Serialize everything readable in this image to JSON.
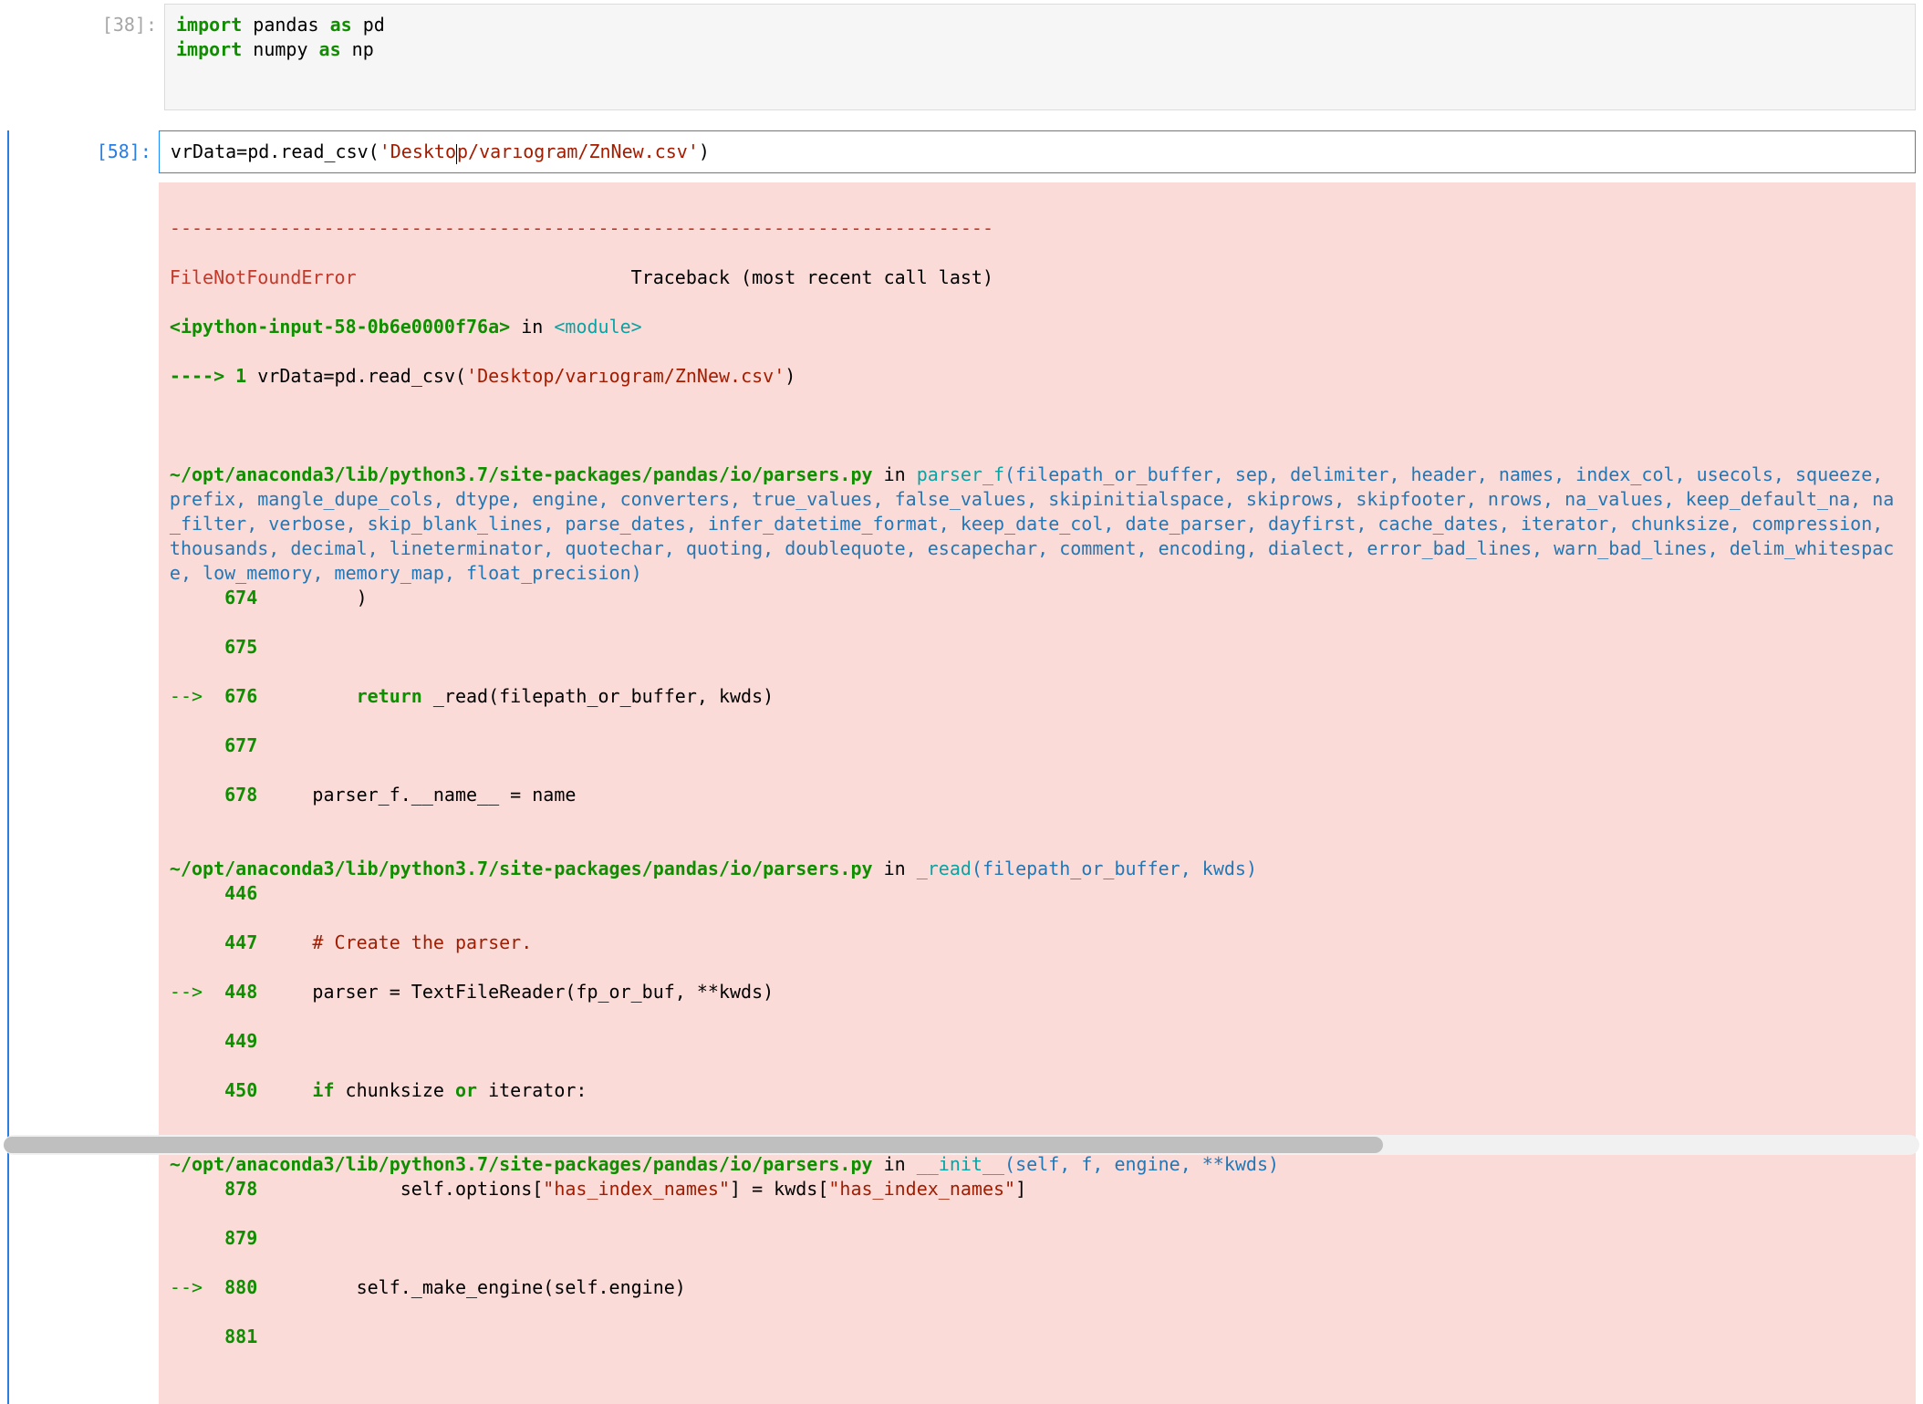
{
  "cell1": {
    "prompt": "[38]:",
    "line1_kw": "import",
    "line1_mid": " pandas ",
    "line1_as": "as",
    "line1_end": " pd",
    "line2_kw": "import",
    "line2_mid": " numpy ",
    "line2_as": "as",
    "line2_end": " np"
  },
  "cell2": {
    "prompt": "[58]:",
    "code_pre": "vrData=pd.read_csv(",
    "code_str_q1": "'",
    "code_str_a": "Deskto",
    "code_str_b": "p/varıogram/ZnNew.csv",
    "code_str_q2": "'",
    "code_post": ")"
  },
  "tb": {
    "dashes": "---------------------------------------------------------------------------",
    "err_name": "FileNotFoundError",
    "err_spacer": "                         ",
    "err_tail": "Traceback (most recent call last)",
    "ipy_in": "<ipython-input-58-0b6e0000f76a>",
    "in_word": " in ",
    "module": "<module>",
    "arrow_long": "----> ",
    "one": "1",
    "line1a": " vrData",
    "line1eq": "=",
    "line1b": "pd",
    "line1dot1": ".",
    "line1c": "read_csv",
    "line1paren": "(",
    "line1str": "'Desktop/varıogram/ZnNew.csv'",
    "line1close": ")",
    "loc1_path": "~/opt/anaconda3/lib/python3.7/site-packages/pandas/io/parsers.py",
    "loc1_fn": "parser_f",
    "loc1_args": "(filepath_or_buffer, sep, delimiter, header, names, index_col, usecols, squeeze, prefix, mangle_dupe_cols, dtype, engine, converters, true_values, false_values, skipinitialspace, skiprows, skipfooter, nrows, na_values, keep_default_na, na_filter, verbose, skip_blank_lines, parse_dates, infer_datetime_format, keep_date_col, date_parser, dayfirst, cache_dates, iterator, chunksize, compression, thousands, decimal, lineterminator, quotechar, quoting, doublequote, escapechar, comment, encoding, dialect, error_bad_lines, warn_bad_lines, delim_whitespace, low_memory, memory_map, float_precision)",
    "l674_no": "674",
    "l674_body": "        )",
    "l675_no": "675",
    "l675_body": "",
    "l676_arrow": "--> ",
    "l676_no": "676",
    "l676_return": "        return",
    "l676_body": " _read(filepath_or_buffer, kwds)",
    "l677_no": "677",
    "l677_body": "",
    "l678_no": "678",
    "l678_body": "    parser_f.__name__ = name",
    "loc2_path": "~/opt/anaconda3/lib/python3.7/site-packages/pandas/io/parsers.py",
    "loc2_fn": "_read",
    "loc2_args": "(filepath_or_buffer, kwds)",
    "l446_no": "446",
    "l446_body": "",
    "l447_no": "447",
    "l447_comment": "    # Create the parser.",
    "l448_arrow": "--> ",
    "l448_no": "448",
    "l448_body": "    parser = TextFileReader(fp_or_buf, **kwds)",
    "l449_no": "449",
    "l449_body": "",
    "l450_no": "450",
    "l450_if": "    if",
    "l450_body": " chunksize ",
    "l450_or": "or",
    "l450_body2": " iterator:",
    "loc3_path": "~/opt/anaconda3/lib/python3.7/site-packages/pandas/io/parsers.py",
    "loc3_fn": "__init__",
    "loc3_args": "(self, f, engine, **kwds)",
    "l878_no": "878",
    "l878_pre": "            self.options[",
    "l878_s1": "\"has_index_names\"",
    "l878_mid": "] = kwds[",
    "l878_s2": "\"has_index_names\"",
    "l878_end": "]",
    "l879_no": "879",
    "l879_body": "",
    "l880_arrow": "--> ",
    "l880_no": "880",
    "l880_body": "        self._make_engine(self.engine)",
    "l881_no": "881",
    "l881_body": ""
  }
}
